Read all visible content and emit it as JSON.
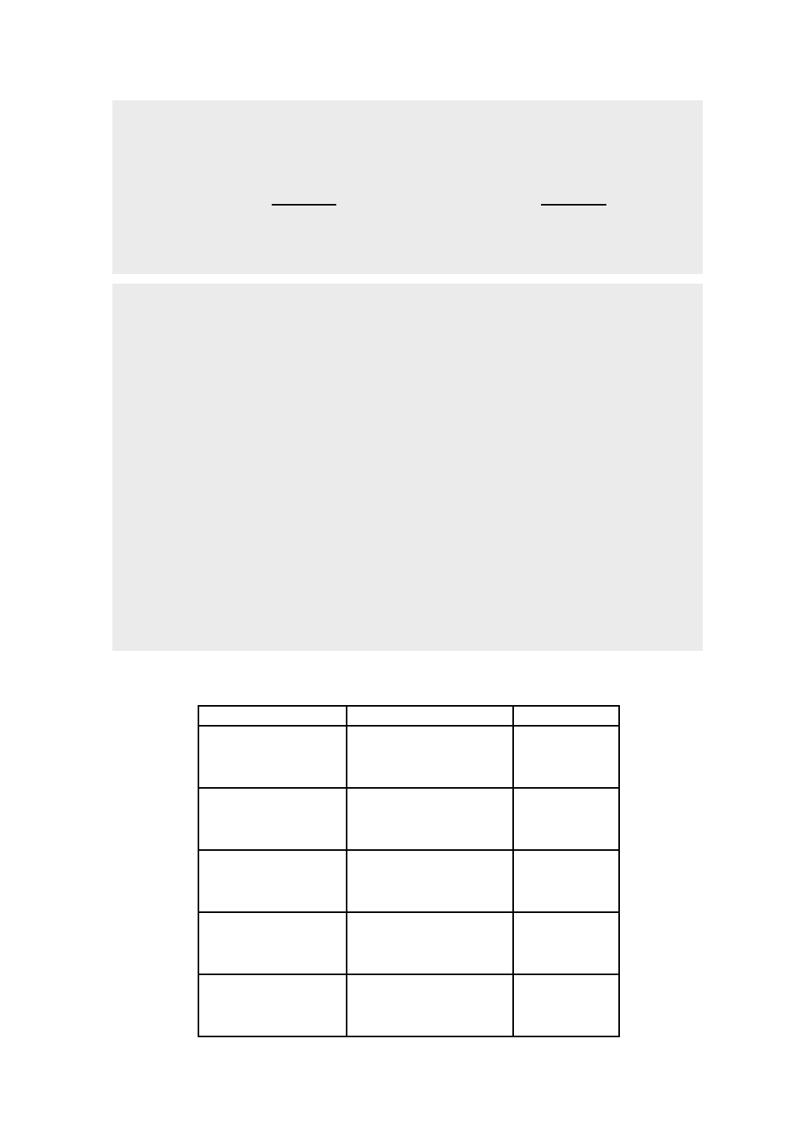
{
  "top_panel": {
    "blank_1": "",
    "blank_2": ""
  },
  "middle_panel": {
    "content": ""
  },
  "table": {
    "headers": [
      "",
      "",
      ""
    ],
    "rows": [
      [
        "",
        "",
        ""
      ],
      [
        "",
        "",
        ""
      ],
      [
        "",
        "",
        ""
      ],
      [
        "",
        "",
        ""
      ],
      [
        "",
        "",
        ""
      ]
    ]
  }
}
